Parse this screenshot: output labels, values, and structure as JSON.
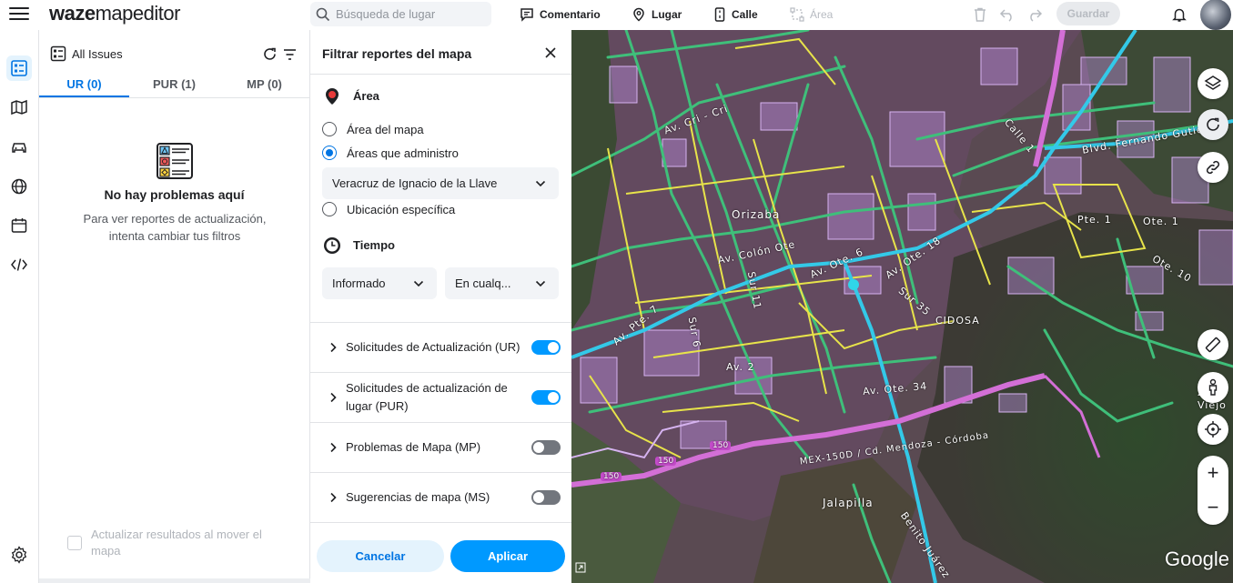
{
  "app": {
    "logo_part1": "waze",
    "logo_part2": "mapeditor"
  },
  "toolbar": {
    "search_placeholder": "Búsqueda de lugar",
    "comment_label": "Comentario",
    "place_label": "Lugar",
    "street_label": "Calle",
    "area_label": "Área",
    "save_label": "Guardar"
  },
  "issues_panel": {
    "title": "All Issues",
    "tabs": [
      {
        "label": "UR (0)",
        "active": true
      },
      {
        "label": "PUR (1)",
        "active": false
      },
      {
        "label": "MP (0)",
        "active": false
      }
    ],
    "empty_title": "No hay problemas aquí",
    "empty_text": "Para ver reportes de actualización, intenta cambiar tus filtros",
    "refresh_on_move_label": "Actualizar resultados al mover el mapa"
  },
  "filter_panel": {
    "title": "Filtrar reportes del mapa",
    "area_section": "Área",
    "area_options": [
      {
        "label": "Área del mapa",
        "selected": false
      },
      {
        "label": "Áreas que administro",
        "selected": true
      },
      {
        "label": "Ubicación específica",
        "selected": false
      }
    ],
    "area_select_value": "Veracruz de Ignacio de la Llave",
    "time_section": "Tiempo",
    "time_select_1": "Informado",
    "time_select_2": "En cualq...",
    "toggles": [
      {
        "label": "Solicitudes de Actualización (UR)",
        "on": true
      },
      {
        "label": "Solicitudes de actualización de lugar (PUR)",
        "on": true
      },
      {
        "label": "Problemas de Mapa (MP)",
        "on": false
      },
      {
        "label": "Sugerencias de mapa (MS)",
        "on": false
      }
    ],
    "cancel_label": "Cancelar",
    "apply_label": "Aplicar"
  },
  "map": {
    "attribution": "Google",
    "labels": {
      "orizaba": "Orizaba",
      "jalapilla": "Jalapilla",
      "cidosa": "CIDOSA",
      "zoo_viejo": "Zoo Viejo",
      "av_cri_cri": "Av. Cri - Cri",
      "av_colon_ote": "Av. Colón Ote",
      "av_ote_6": "Av. Ote. 6",
      "av_ote_34": "Av. Ote. 34",
      "av_pte_7": "Av. Pte. 7",
      "av_2": "Av. 2",
      "av_ote_18": "Av. Ote. 18",
      "blvd_fernando": "Blvd. Fernando Gutiérrez",
      "mex_150d": "MEX-150D / Cd. Mendoza - Córdoba",
      "pte_1": "Pte. 1",
      "ote_1": "Ote. 1",
      "ote_10": "Ote. 10",
      "sur_35": "Sur 35",
      "sur_11": "Sur 11",
      "sur_6": "Sur 6",
      "benito_juarez": "Benito Juárez",
      "calle_1": "Calle 1",
      "shield_150_a": "150",
      "shield_150_b": "150",
      "shield_150_c": "150"
    }
  }
}
